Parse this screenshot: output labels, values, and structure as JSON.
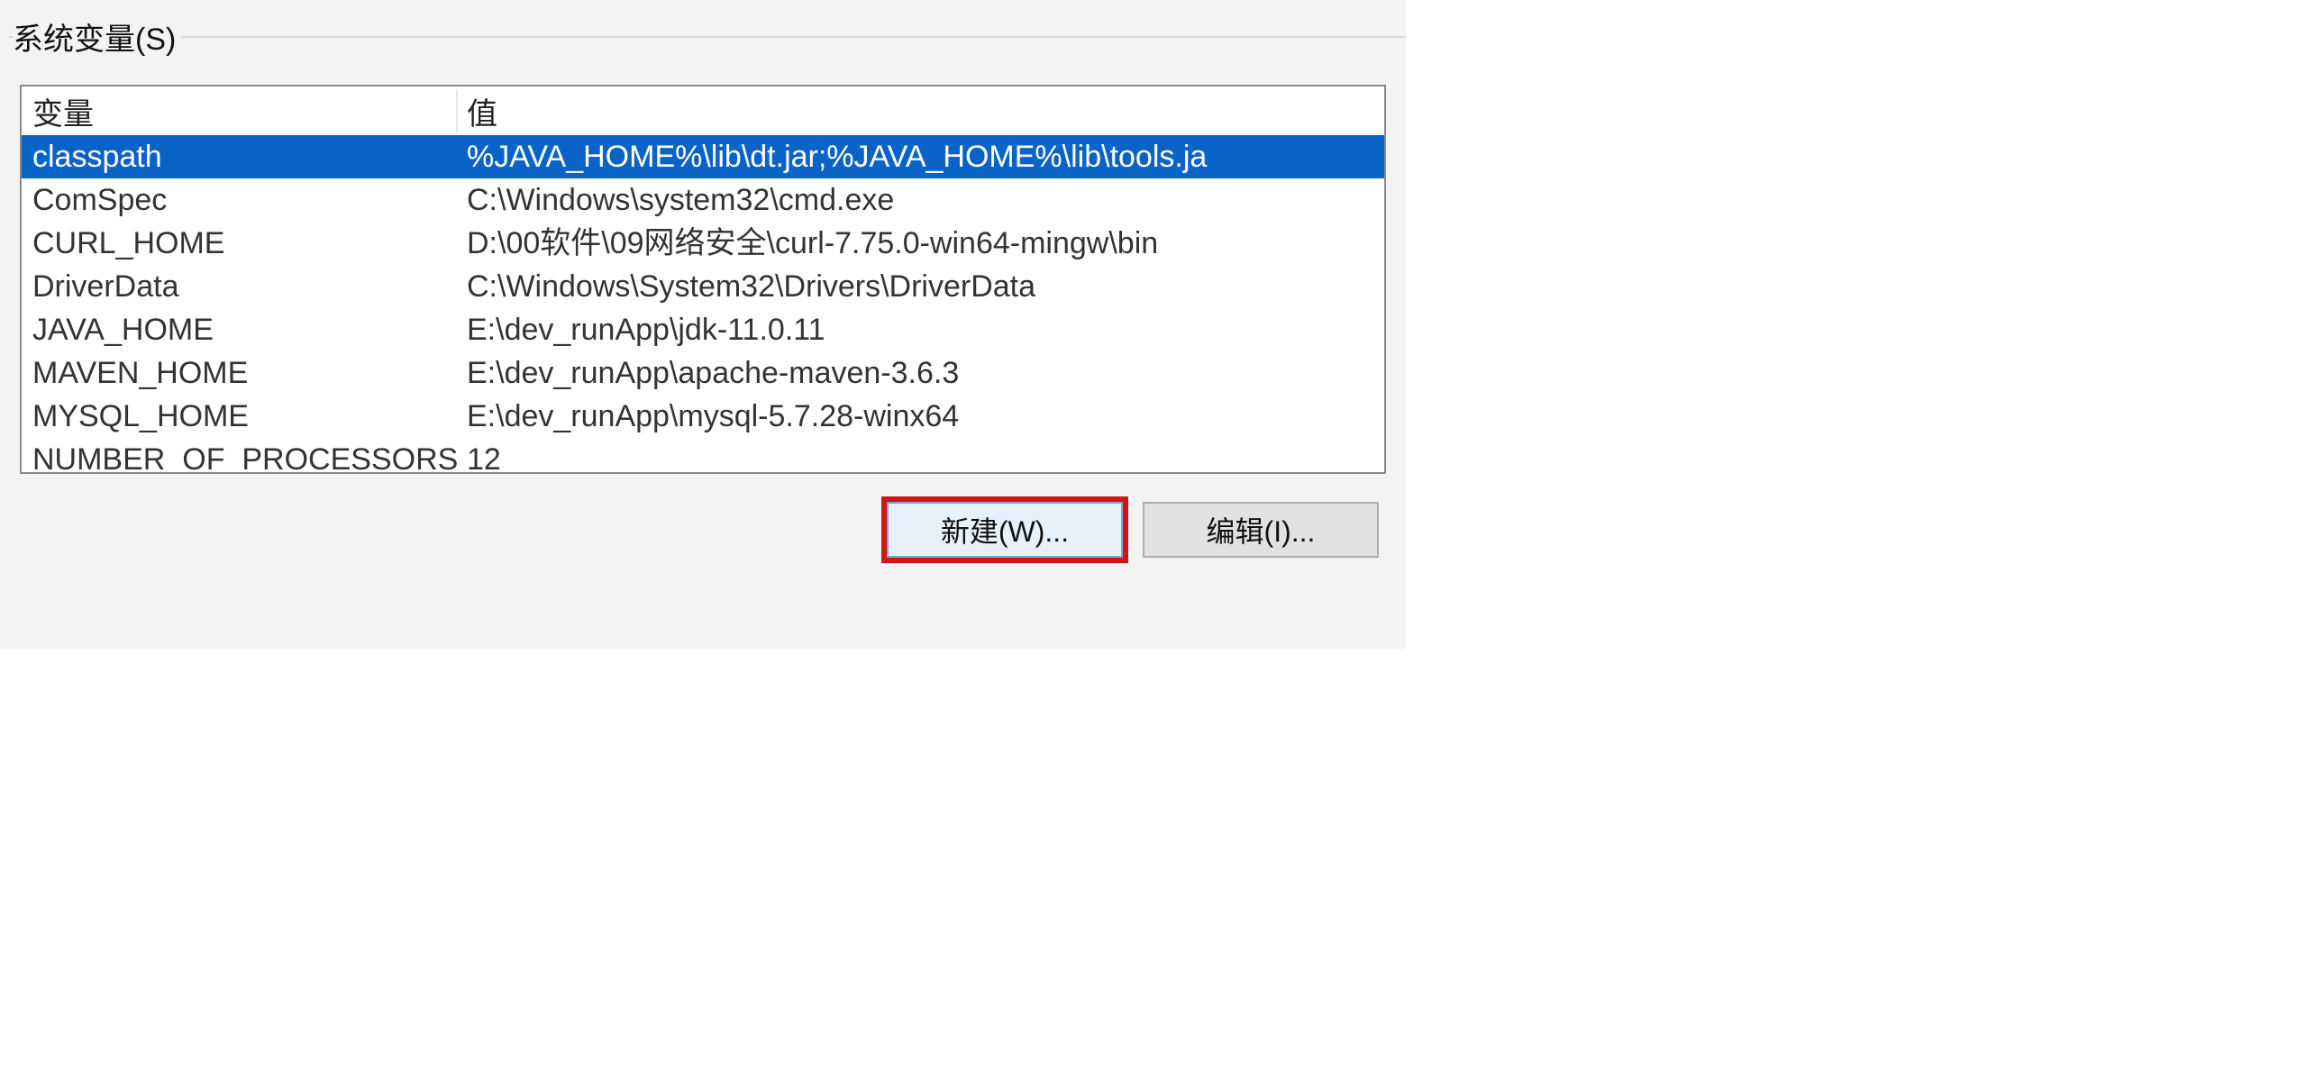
{
  "group": {
    "legend": "系统变量(S)"
  },
  "columns": {
    "name": "变量",
    "value": "值"
  },
  "rows": [
    {
      "name": "classpath",
      "value": "%JAVA_HOME%\\lib\\dt.jar;%JAVA_HOME%\\lib\\tools.ja",
      "selected": true
    },
    {
      "name": "ComSpec",
      "value": "C:\\Windows\\system32\\cmd.exe",
      "selected": false
    },
    {
      "name": "CURL_HOME",
      "value": "D:\\00软件\\09网络安全\\curl-7.75.0-win64-mingw\\bin",
      "selected": false
    },
    {
      "name": "DriverData",
      "value": "C:\\Windows\\System32\\Drivers\\DriverData",
      "selected": false
    },
    {
      "name": "JAVA_HOME",
      "value": "E:\\dev_runApp\\jdk-11.0.11",
      "selected": false
    },
    {
      "name": "MAVEN_HOME",
      "value": "E:\\dev_runApp\\apache-maven-3.6.3",
      "selected": false
    },
    {
      "name": "MYSQL_HOME",
      "value": "E:\\dev_runApp\\mysql-5.7.28-winx64",
      "selected": false
    },
    {
      "name": "NUMBER_OF_PROCESSORS",
      "value": "12",
      "selected": false,
      "cutoff": true
    }
  ],
  "buttons": {
    "new": "新建(W)...",
    "edit": "编辑(I)..."
  }
}
